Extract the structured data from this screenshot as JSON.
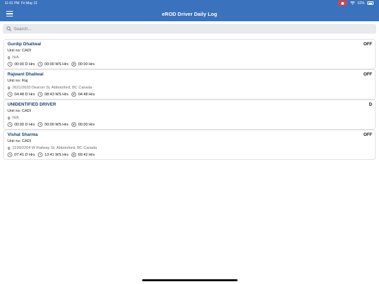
{
  "status_bar": {
    "time": "11:01 PM",
    "date": "Fri May 22",
    "battery": "62%"
  },
  "header": {
    "title": "eROD Driver Daily Log",
    "menu_icon": "hamburger-icon"
  },
  "search": {
    "placeholder": "Search...",
    "value": ""
  },
  "drivers": [
    {
      "name": "Gurdip Dhaliwal",
      "status": "OFF",
      "unit": "Unit no: CADI",
      "location": "N/A",
      "drive": "00:00 D Hrs",
      "work_shift": "00:00 WS Hrs",
      "cycle": "00:00 Hrs"
    },
    {
      "name": "Rajwant Dhaliwal",
      "status": "OFF",
      "unit": "Unit no: Raj",
      "location": "2621/2620 Deacon St, Abbotsford, BC Canada",
      "drive": "04:48 D Hrs",
      "work_shift": "08:43 WS Hrs",
      "cycle": "04:48 Hrs"
    },
    {
      "name": "UNIDENTIFIED DRIVER",
      "status": "D",
      "unit": "Unit no: CADI",
      "location": "N/A",
      "drive": "00:00 D Hrs",
      "work_shift": "00:00 WS Hrs",
      "cycle": "00:00 Hrs"
    },
    {
      "name": "Vishal Sharma",
      "status": "OFF",
      "unit": "Unit no: CADI",
      "location": "2199/2204 W Railway St, Abbotsford, BC Canada",
      "drive": "07:41 D Hrs",
      "work_shift": "13:41 WS Hrs",
      "cycle": "69:42 Hrs"
    }
  ],
  "colors": {
    "header_bg": "#3a72bd",
    "name_text": "#1f3f73",
    "record_indicator": "#e0453a"
  }
}
